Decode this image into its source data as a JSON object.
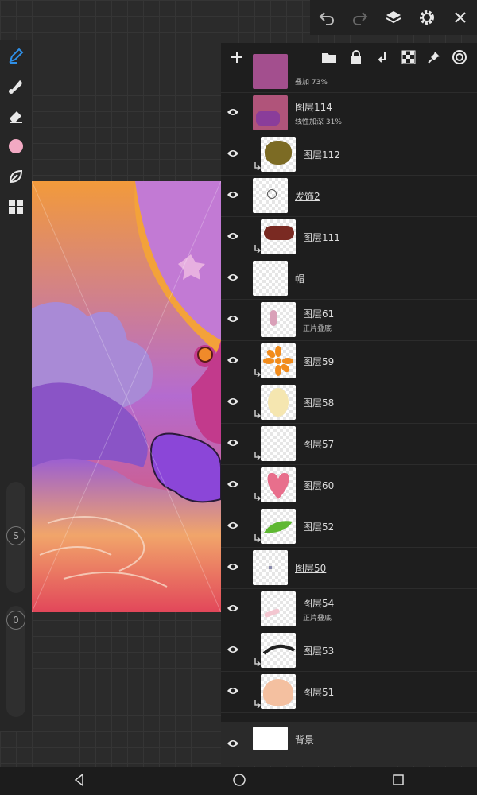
{
  "colors": {
    "accent": "#2f8fe6",
    "brush_color": "#f2a9c3",
    "panel_bg": "#1e1e1e"
  },
  "toolbar": {
    "icons": [
      "undo-icon",
      "redo-icon",
      "layers-icon",
      "gear-icon",
      "close-icon"
    ]
  },
  "tools": {
    "icons": [
      "pen-icon",
      "smudge-icon",
      "eraser-icon",
      "color-swatch",
      "leaf-icon",
      "grid-icon"
    ],
    "size_badge": "S",
    "opacity_badge": "0"
  },
  "panel": {
    "header_icons": [
      "add-icon",
      "folder-icon",
      "lock-icon",
      "merge-down-icon",
      "checker-icon",
      "pin-icon",
      "target-icon"
    ],
    "layers": [
      {
        "name": "",
        "sub": "叠加 73%"
      },
      {
        "name": "图层114",
        "sub": "线性加深 31%"
      },
      {
        "name": "图层112",
        "sub": ""
      },
      {
        "name": "发饰2",
        "sub": ""
      },
      {
        "name": "图层111",
        "sub": ""
      },
      {
        "name": "帽",
        "sub": ""
      },
      {
        "name": "图层61",
        "sub": "正片叠底"
      },
      {
        "name": "图层59",
        "sub": ""
      },
      {
        "name": "图层58",
        "sub": ""
      },
      {
        "name": "图层57",
        "sub": ""
      },
      {
        "name": "图层60",
        "sub": ""
      },
      {
        "name": "图层52",
        "sub": ""
      },
      {
        "name": "图层50",
        "sub": ""
      },
      {
        "name": "图层54",
        "sub": "正片叠底"
      },
      {
        "name": "图层53",
        "sub": ""
      },
      {
        "name": "图层51",
        "sub": ""
      },
      {
        "name": "背景",
        "sub": ""
      }
    ]
  },
  "nav": {
    "icons": [
      "back-icon",
      "home-icon",
      "recents-icon"
    ]
  }
}
